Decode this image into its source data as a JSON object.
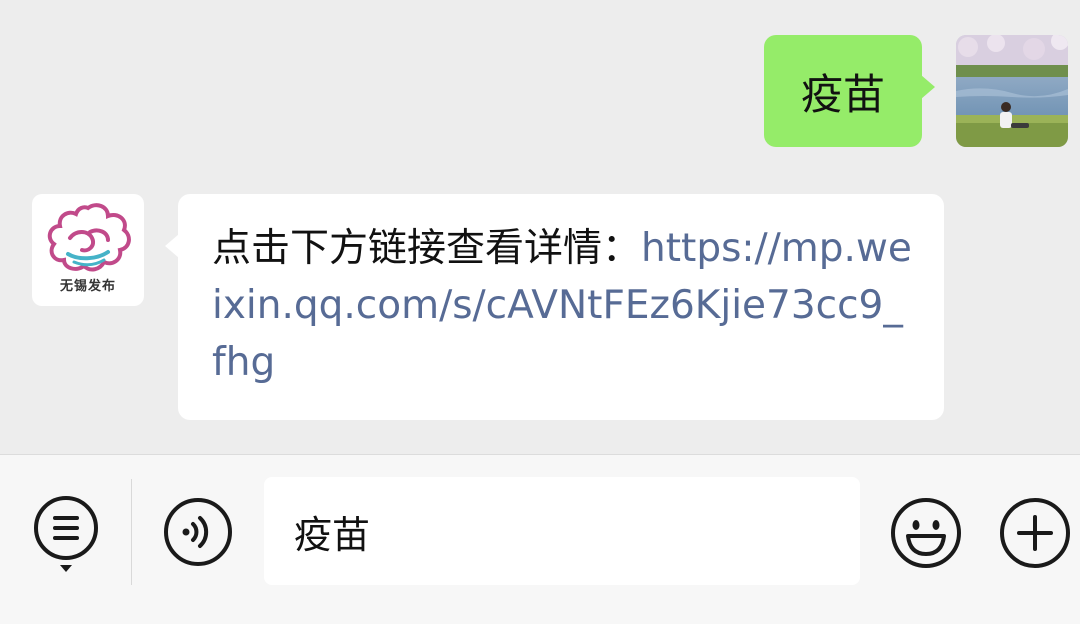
{
  "conversation": {
    "outgoing": {
      "text": "疫苗",
      "bubble_color": "#95ec69"
    },
    "incoming": {
      "avatar_caption": "无锡发布",
      "prefix": "点击下方链接查看详情：",
      "link": "https://mp.weixin.qq.com/s/cAVNtFEz6Kjie73cc9_fhg",
      "link_color": "#576b95"
    }
  },
  "input_bar": {
    "value": "疫苗",
    "icons": [
      "menu-icon",
      "voice-icon",
      "emoji-icon",
      "plus-icon"
    ]
  }
}
